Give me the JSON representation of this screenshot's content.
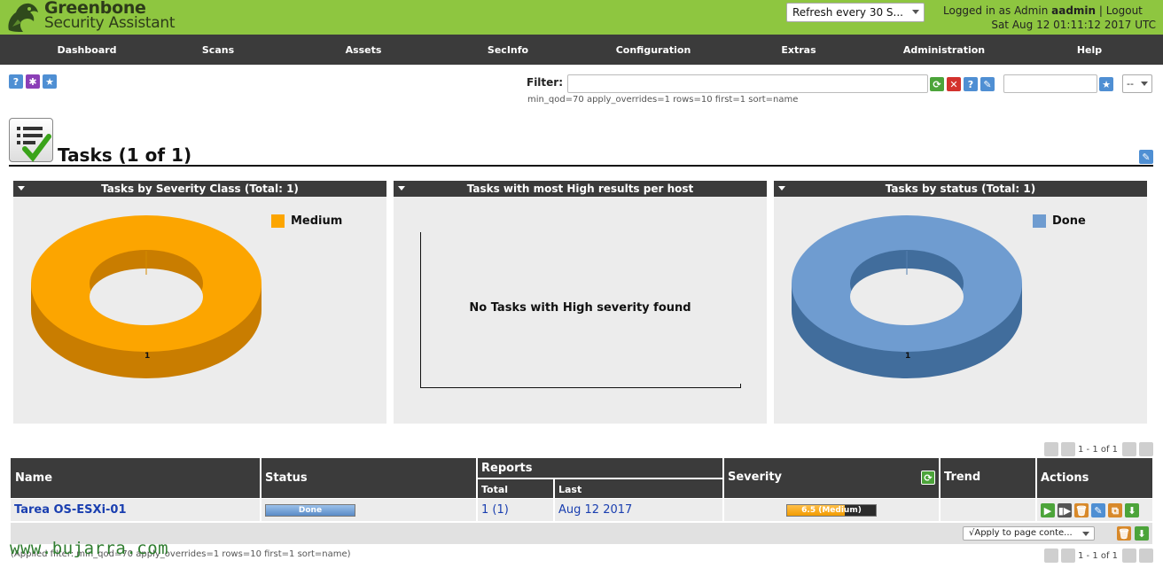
{
  "app": {
    "brand_line1": "Greenbone",
    "brand_line2": "Security Assistant"
  },
  "header": {
    "refresh_select": "Refresh every 30 S...",
    "logged_in_as": "Logged in as",
    "role": "Admin",
    "username": "aadmin",
    "separator": "|",
    "logout": "Logout",
    "datetime": "Sat Aug 12 01:11:12 2017 UTC"
  },
  "nav": [
    "Dashboard",
    "Scans",
    "Assets",
    "SecInfo",
    "Configuration",
    "Extras",
    "Administration",
    "Help"
  ],
  "toolbar": {
    "help_icon": "question-icon",
    "wizard_icon": "wizard-icon",
    "new_icon": "star-icon"
  },
  "filter": {
    "label": "Filter:",
    "value": "",
    "applied_text": "min_qod=70 apply_overrides=1 rows=10 first=1 sort=name",
    "name_value": "",
    "select_value": "--"
  },
  "page": {
    "title": "Tasks (1 of 1)"
  },
  "charts": [
    {
      "title": "Tasks by Severity Class (Total: 1)",
      "legend": "Medium",
      "center_label": "1",
      "color": "#fca500"
    },
    {
      "title": "Tasks with most High results per host",
      "empty_text": "No Tasks with High severity found"
    },
    {
      "title": "Tasks by status (Total: 1)",
      "legend": "Done",
      "center_label": "1",
      "color": "#6f9cd0"
    }
  ],
  "chart_data": [
    {
      "type": "pie",
      "title": "Tasks by Severity Class (Total: 1)",
      "categories": [
        "Medium"
      ],
      "values": [
        1
      ]
    },
    {
      "type": "bar",
      "title": "Tasks with most High results per host",
      "categories": [],
      "values": []
    },
    {
      "type": "pie",
      "title": "Tasks by status (Total: 1)",
      "categories": [
        "Done"
      ],
      "values": [
        1
      ]
    }
  ],
  "pager": {
    "text": "1 - 1 of 1"
  },
  "table": {
    "headers": {
      "name": "Name",
      "status": "Status",
      "reports": "Reports",
      "total": "Total",
      "last": "Last",
      "severity": "Severity",
      "trend": "Trend",
      "actions": "Actions"
    },
    "rows": [
      {
        "name": "Tarea OS-ESXi-01",
        "status": "Done",
        "progress": 1.0,
        "reports_total": "1 (1)",
        "reports_last": "Aug 12 2017",
        "severity": "6.5 (Medium)",
        "severity_fraction": 0.65,
        "trend": ""
      }
    ]
  },
  "bulk": {
    "select": "√Apply to page conte..."
  },
  "applied_filter": "(Applied filter: min_qod=70 apply_overrides=1 rows=10 first=1 sort=name)",
  "watermark": "www.bujarra.com",
  "colors": {
    "header_green": "#8ec640",
    "nav_dark": "#3b3b3b",
    "medium": "#fca500",
    "done": "#6f9cd0"
  }
}
